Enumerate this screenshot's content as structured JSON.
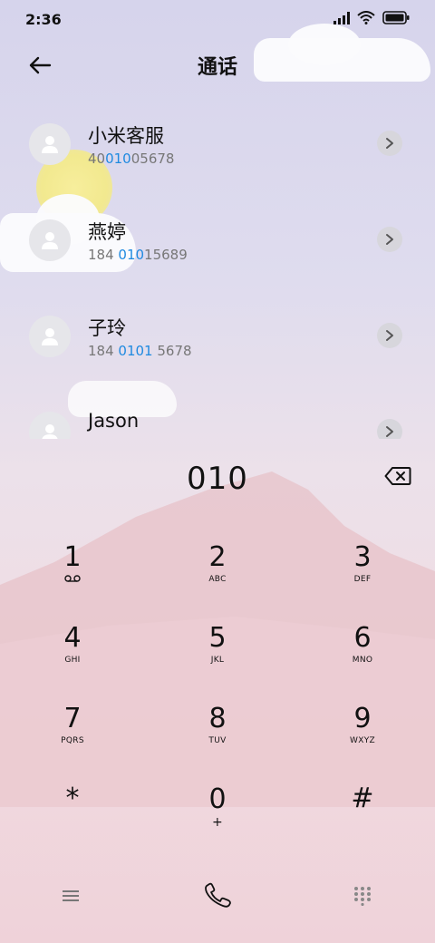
{
  "status_bar": {
    "time": "2:36"
  },
  "header": {
    "title": "通话"
  },
  "contacts": [
    {
      "name": "小米客服",
      "number_pre": "40",
      "number_hl": "010",
      "number_post": "05678"
    },
    {
      "name": "燕婷",
      "number_pre": "184 ",
      "number_hl": "010",
      "number_post": "15689"
    },
    {
      "name": "子玲",
      "number_pre": "184 ",
      "number_hl": "0101",
      "number_post": " 5678"
    },
    {
      "name": "Jason",
      "number_pre": "",
      "number_hl": "",
      "number_post": ""
    }
  ],
  "dialer": {
    "number": "010"
  },
  "keys": [
    {
      "digit": "1",
      "letters": ""
    },
    {
      "digit": "2",
      "letters": "ABC"
    },
    {
      "digit": "3",
      "letters": "DEF"
    },
    {
      "digit": "4",
      "letters": "GHI"
    },
    {
      "digit": "5",
      "letters": "JKL"
    },
    {
      "digit": "6",
      "letters": "MNO"
    },
    {
      "digit": "7",
      "letters": "PQRS"
    },
    {
      "digit": "8",
      "letters": "TUV"
    },
    {
      "digit": "9",
      "letters": "WXYZ"
    },
    {
      "digit": "*",
      "letters": ""
    },
    {
      "digit": "0",
      "letters": "+"
    },
    {
      "digit": "#",
      "letters": ""
    }
  ],
  "icons": {
    "back": "arrow-left-icon",
    "chevron": "chevron-right-icon",
    "backspace": "backspace-icon",
    "voicemail": "voicemail-icon",
    "menu": "menu-icon",
    "call": "phone-icon",
    "keypad": "dialpad-icon"
  },
  "colors": {
    "highlight": "#1f8ae0",
    "text": "#111111"
  }
}
